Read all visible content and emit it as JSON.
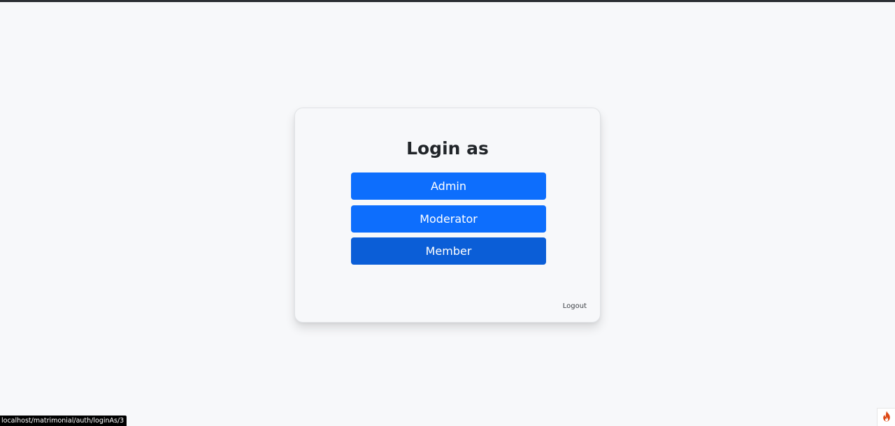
{
  "card": {
    "title": "Login as",
    "buttons": [
      {
        "label": "Admin"
      },
      {
        "label": "Moderator"
      },
      {
        "label": "Member"
      }
    ],
    "logout_label": "Logout"
  },
  "status_bar": {
    "url": "localhost/matrimonial/auth/loginAs/3"
  },
  "icons": {
    "debug_toolbar": "flame-icon"
  },
  "colors": {
    "primary": "#0d6efd",
    "primary_hover": "#0b5ed7",
    "background": "#f7f8fa",
    "title_text": "#212529",
    "flame": "#dd4814"
  }
}
